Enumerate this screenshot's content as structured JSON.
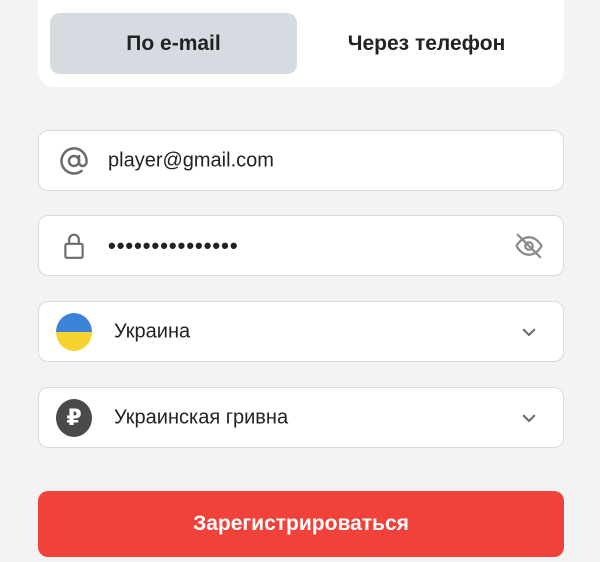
{
  "tabs": {
    "email_label": "По e-mail",
    "phone_label": "Через телефон"
  },
  "form": {
    "email_value": "player@gmail.com",
    "password_value": "•••••••••••••••",
    "country_value": "Украина",
    "currency_value": "Украинская гривна",
    "currency_symbol": "₽",
    "submit_label": "Зарегистрироваться"
  },
  "icons": {
    "email": "at-icon",
    "password": "lock-icon",
    "visibility": "eye-off-icon",
    "country_flag": "ukraine-flag-icon",
    "currency": "ruble-icon",
    "dropdown": "chevron-down-icon"
  },
  "colors": {
    "accent": "#f0413a",
    "tab_active_bg": "#d5dbe1",
    "flag_blue": "#3b82d9",
    "flag_yellow": "#f6d32e",
    "icon_gray": "#6b6b6b"
  }
}
